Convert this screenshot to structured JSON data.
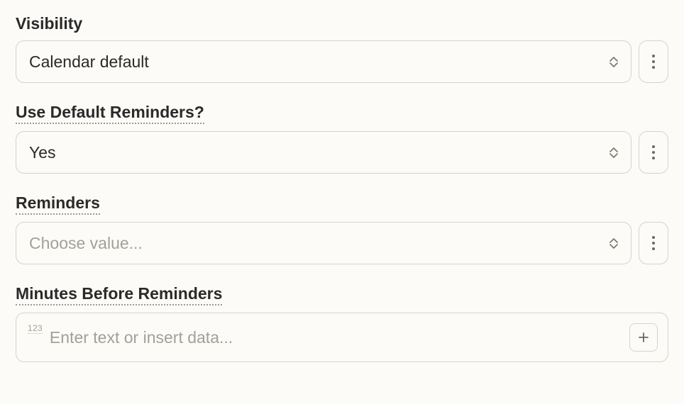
{
  "visibility": {
    "label": "Visibility",
    "value": "Calendar default"
  },
  "use_default_reminders": {
    "label": "Use Default Reminders?",
    "value": "Yes"
  },
  "reminders": {
    "label": "Reminders",
    "placeholder": "Choose value..."
  },
  "minutes_before": {
    "label": "Minutes Before Reminders",
    "type_hint": "123",
    "placeholder": "Enter text or insert data..."
  }
}
